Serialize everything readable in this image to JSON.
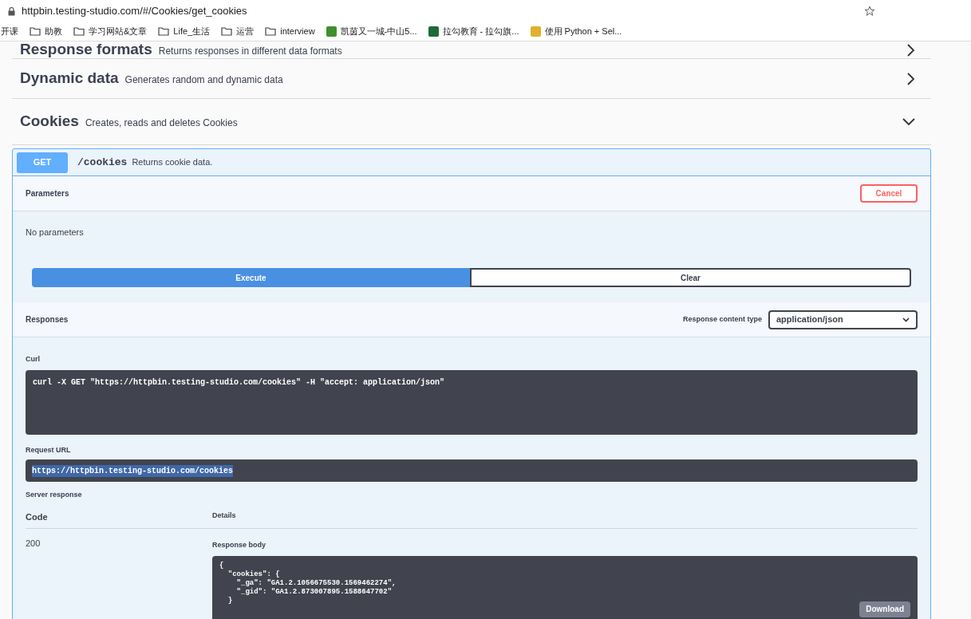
{
  "browser": {
    "url": "httpbin.testing-studio.com/#/Cookies/get_cookies",
    "bookmarks": [
      {
        "kind": "plain",
        "label": "开课"
      },
      {
        "kind": "folder",
        "label": "助教"
      },
      {
        "kind": "folder",
        "label": "学习网站&文章"
      },
      {
        "kind": "folder",
        "label": "Life_生活"
      },
      {
        "kind": "folder",
        "label": "运营"
      },
      {
        "kind": "folder",
        "label": "interview"
      },
      {
        "kind": "site",
        "label": "凯茵又一城-中山5...",
        "color": "#3f8f2f"
      },
      {
        "kind": "site",
        "label": "拉勾教育 - 拉勾旗...",
        "color": "#1e6b3a"
      },
      {
        "kind": "site",
        "label": "使用 Python + Sel...",
        "color": "#e0b030"
      }
    ]
  },
  "sections": [
    {
      "title": "Response formats",
      "description": "Returns responses in different data formats",
      "expanded": false
    },
    {
      "title": "Dynamic data",
      "description": "Generates random and dynamic data",
      "expanded": false
    },
    {
      "title": "Cookies",
      "description": "Creates, reads and deletes Cookies",
      "expanded": true
    }
  ],
  "operation": {
    "method": "GET",
    "path": "/cookies",
    "summary": "Returns cookie data.",
    "parameters_title": "Parameters",
    "cancel": "Cancel",
    "no_parameters": "No parameters",
    "execute": "Execute",
    "clear": "Clear",
    "responses_title": "Responses",
    "content_type_label": "Response content type",
    "content_type": "application/json",
    "curl_label": "Curl",
    "curl": "curl -X GET \"https://httpbin.testing-studio.com/cookies\" -H \"accept: application/json\"",
    "request_url_label": "Request URL",
    "request_url": "https://httpbin.testing-studio.com/cookies",
    "server_response_label": "Server response",
    "code_header": "Code",
    "details_header": "Details",
    "code": "200",
    "response_body_label": "Response body",
    "response_body": "{\n  \"cookies\": {\n    \"_ga\": \"GA1.2.1056675530.1569462274\",\n    \"_gid\": \"GA1.2.873007895.1588647702\"\n  }",
    "download": "Download"
  }
}
